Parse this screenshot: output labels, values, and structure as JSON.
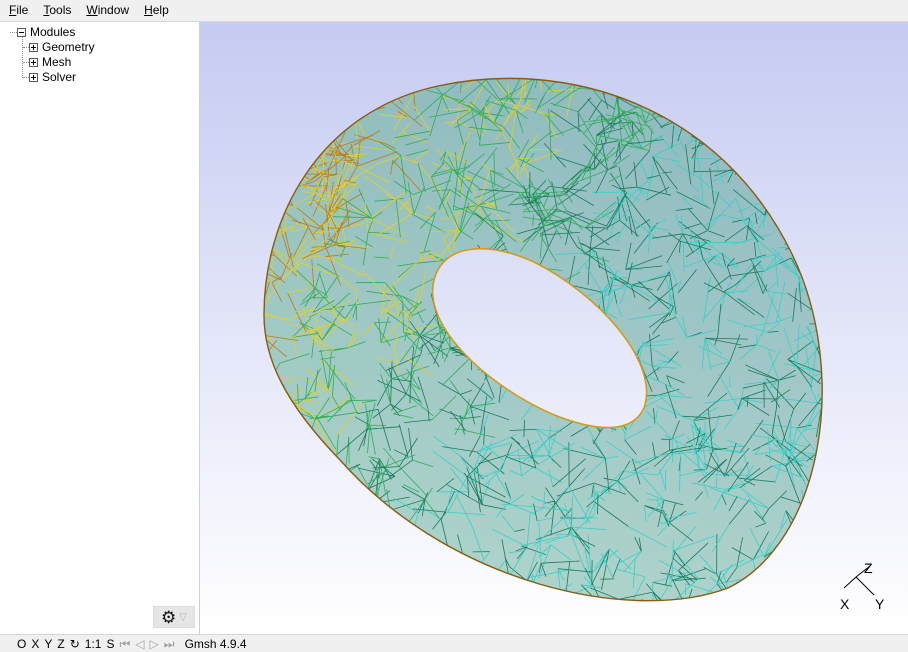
{
  "menubar": {
    "items": [
      {
        "accel": "F",
        "rest": "ile"
      },
      {
        "accel": "T",
        "rest": "ools"
      },
      {
        "accel": "W",
        "rest": "indow"
      },
      {
        "accel": "H",
        "rest": "elp"
      }
    ]
  },
  "tree": {
    "root": "Modules",
    "children": [
      "Geometry",
      "Mesh",
      "Solver"
    ]
  },
  "viewport": {
    "axes": {
      "z": "Z",
      "x": "X",
      "y": "Y"
    },
    "mesh_colors": [
      "#c07a10",
      "#e8d020",
      "#2fae5a",
      "#1a7a5e",
      "#38d0c8"
    ]
  },
  "statusbar": {
    "btn_o": "O",
    "btn_x": "X",
    "btn_y": "Y",
    "btn_z": "Z",
    "btn_rotate": "↻",
    "btn_scale": "1:1",
    "btn_s": "S",
    "btn_first": "⏮",
    "btn_prev": "◁",
    "btn_play": "▷",
    "btn_last": "⏭",
    "status_text": "Gmsh 4.9.4"
  },
  "sidebar": {
    "gear_icon": "⚙",
    "caret_icon": "▽"
  }
}
